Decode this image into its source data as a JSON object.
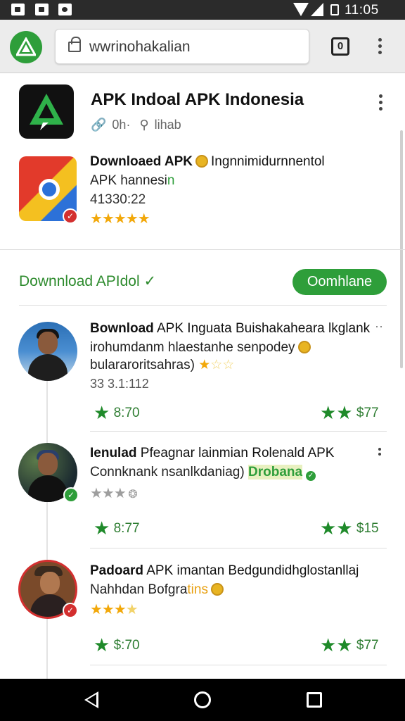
{
  "status_bar": {
    "time": "11:05"
  },
  "browser": {
    "url": "wwrinohakalian",
    "tabs_count": "0"
  },
  "header": {
    "title": "APK Indoal APK Indonesia",
    "meta_left": "0h·",
    "meta_right": "lihab"
  },
  "featured": {
    "title_bold": "Downloaed APK",
    "title_rest": "Ingnnimidurnnentol",
    "subtitle_prefix": "APK hannesi",
    "subtitle_green": "n",
    "number": "41330:22",
    "rating": 5
  },
  "section": {
    "title": "Downnload APIdol ✓",
    "button": "Oomhlane"
  },
  "items": [
    {
      "title_bold": "Bownload",
      "title_rest": " APK Inguata Buishakaheara lkglank",
      "line2": "irohumdanm hlaestanhe senpodey",
      "line3": "bulararoritsahras)",
      "number": "33 3.1:112",
      "metric_left": "8:70",
      "metric_right": "$77",
      "rating": 3
    },
    {
      "title_bold": "Ienulad",
      "title_rest": " Pfeagnar lainmian Rolenald APK",
      "line2_prefix": "Connknank nsanlkdaniag) ",
      "line2_green": "Drobana",
      "metric_left": "8:77",
      "metric_right": "$15",
      "rating": 3
    },
    {
      "title_bold": "Padoard",
      "title_rest": " APK imantan Bedgundidhglostanllaj",
      "line2_prefix": "Nahhdan Bofgra",
      "line2_green": "tins",
      "metric_left": "$:70",
      "metric_right": "$77",
      "rating": 4
    }
  ],
  "colors": {
    "accent_green": "#2e9e3a",
    "star_gold": "#f2a80a",
    "badge_red": "#d32f2f"
  }
}
